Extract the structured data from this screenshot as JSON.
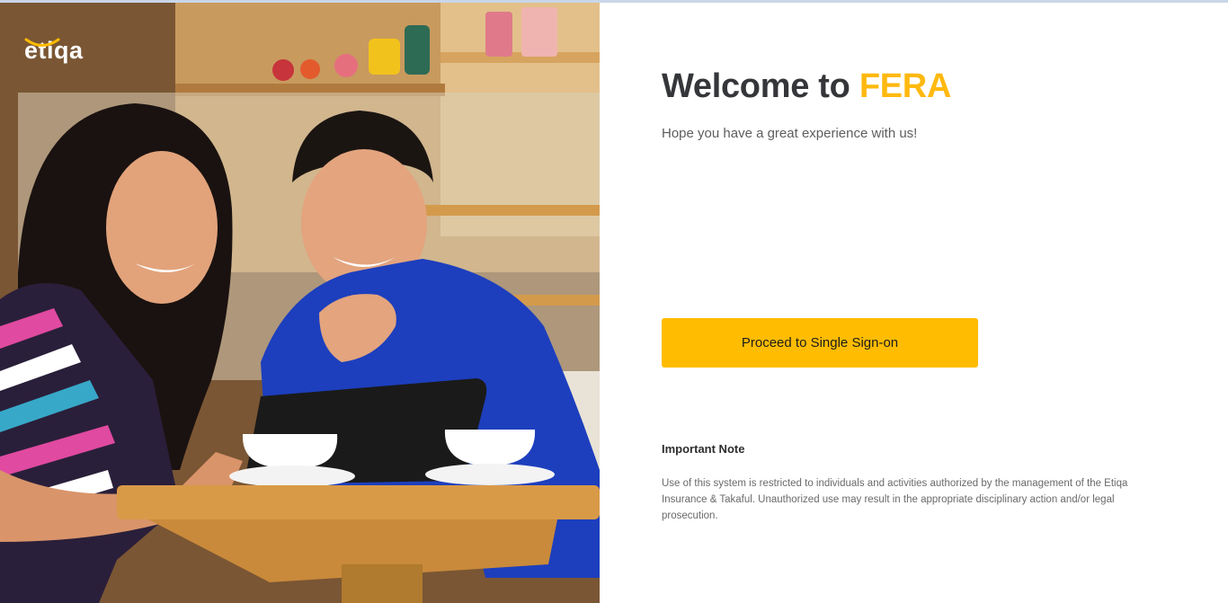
{
  "brand": {
    "logo_text": "etiqa",
    "accent_color": "#ffbc00"
  },
  "hero": {
    "image_description_icon": "photo-two-women-tablet-cafe"
  },
  "welcome": {
    "prefix": "Welcome to",
    "product": "FERA"
  },
  "subtitle": "Hope you have a great experience with us!",
  "sso_button_label": "Proceed to Single Sign-on",
  "note": {
    "heading": "Important Note",
    "body": "Use of this system is restricted to individuals and activities authorized by the management of the Etiqa Insurance & Takaful. Unauthorized use may result in the appropriate disciplinary action and/or legal prosecution."
  }
}
